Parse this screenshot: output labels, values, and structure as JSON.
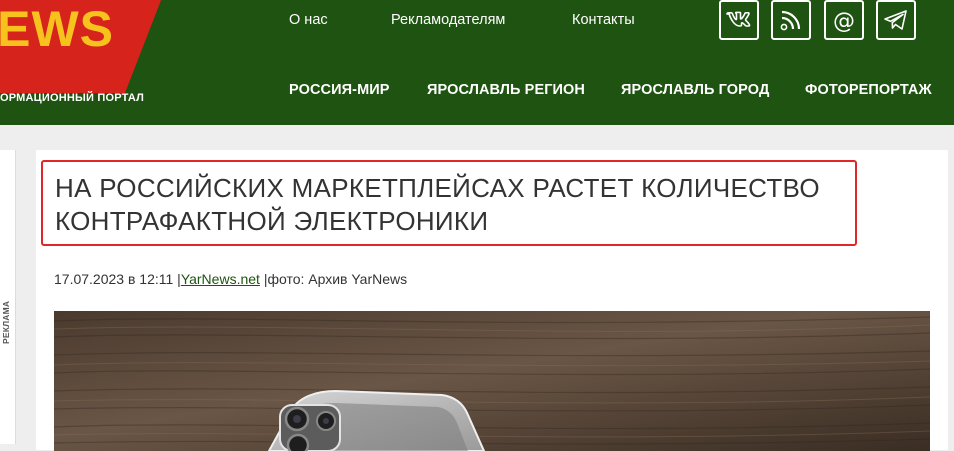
{
  "logo": {
    "name": "NEWS",
    "tagline": "ОРМАЦИОННЫЙ ПОРТАЛ"
  },
  "top_nav": [
    {
      "label": "О нас"
    },
    {
      "label": "Рекламодателям"
    },
    {
      "label": "Контакты"
    }
  ],
  "main_nav": [
    {
      "label": "РОССИЯ-МИР"
    },
    {
      "label": "ЯРОСЛАВЛЬ РЕГИОН"
    },
    {
      "label": "ЯРОСЛАВЛЬ ГОРОД"
    },
    {
      "label": "ФОТОРЕПОРТАЖ"
    }
  ],
  "social": [
    "vk-icon",
    "rss-icon",
    "email-icon",
    "telegram-icon"
  ],
  "sidebar": {
    "ad_label": "РЕКЛАМА"
  },
  "article": {
    "title": "НА РОССИЙСКИХ МАРКЕТПЛЕЙСАХ РАСТЕТ КОЛИЧЕСТВО КОНТРАФАКТНОЙ ЭЛЕКТРОНИКИ",
    "date": "17.07.2023 в 12:11",
    "source": "YarNews.net",
    "photo_credit": "фото: Архив YarNews"
  },
  "colors": {
    "header_bg": "#1f5311",
    "logo_red": "#d6231c",
    "logo_yellow": "#f7c21e",
    "highlight_border": "#e02626"
  }
}
